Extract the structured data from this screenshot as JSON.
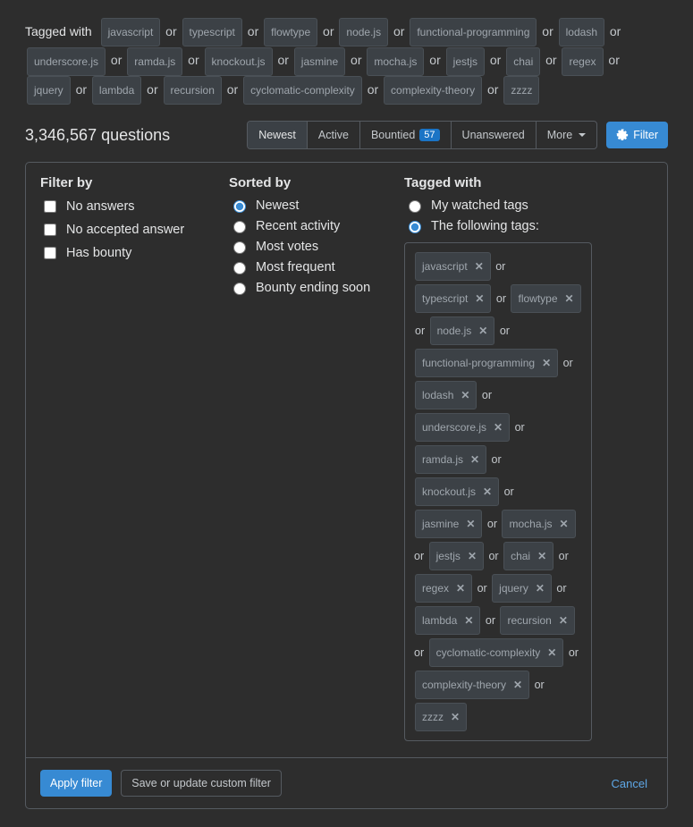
{
  "or_text": "or",
  "header": {
    "tagged_with_label": "Tagged with",
    "tags": [
      "javascript",
      "typescript",
      "flowtype",
      "node.js",
      "functional-programming",
      "lodash",
      "underscore.js",
      "ramda.js",
      "knockout.js",
      "jasmine",
      "mocha.js",
      "jestjs",
      "chai",
      "regex",
      "jquery",
      "lambda",
      "recursion",
      "cyclomatic-complexity",
      "complexity-theory",
      "zzzz"
    ]
  },
  "headline": {
    "count_text": "3,346,567 questions"
  },
  "tabs": {
    "newest": "Newest",
    "active": "Active",
    "bountied": "Bountied",
    "bountied_count": "57",
    "unanswered": "Unanswered",
    "more": "More"
  },
  "filter_button": "Filter",
  "panel": {
    "filter_by": {
      "title": "Filter by",
      "no_answers": "No answers",
      "no_accepted": "No accepted answer",
      "has_bounty": "Has bounty"
    },
    "sorted_by": {
      "title": "Sorted by",
      "newest": "Newest",
      "recent": "Recent activity",
      "votes": "Most votes",
      "frequent": "Most frequent",
      "bounty_ending": "Bounty ending soon"
    },
    "tagged_with": {
      "title": "Tagged with",
      "watched": "My watched tags",
      "following": "The following tags:",
      "tags": [
        "javascript",
        "typescript",
        "flowtype",
        "node.js",
        "functional-programming",
        "lodash",
        "underscore.js",
        "ramda.js",
        "knockout.js",
        "jasmine",
        "mocha.js",
        "jestjs",
        "chai",
        "regex",
        "jquery",
        "lambda",
        "recursion",
        "cyclomatic-complexity",
        "complexity-theory",
        "zzzz"
      ]
    },
    "footer": {
      "apply": "Apply filter",
      "save": "Save or update custom filter",
      "cancel": "Cancel"
    }
  }
}
